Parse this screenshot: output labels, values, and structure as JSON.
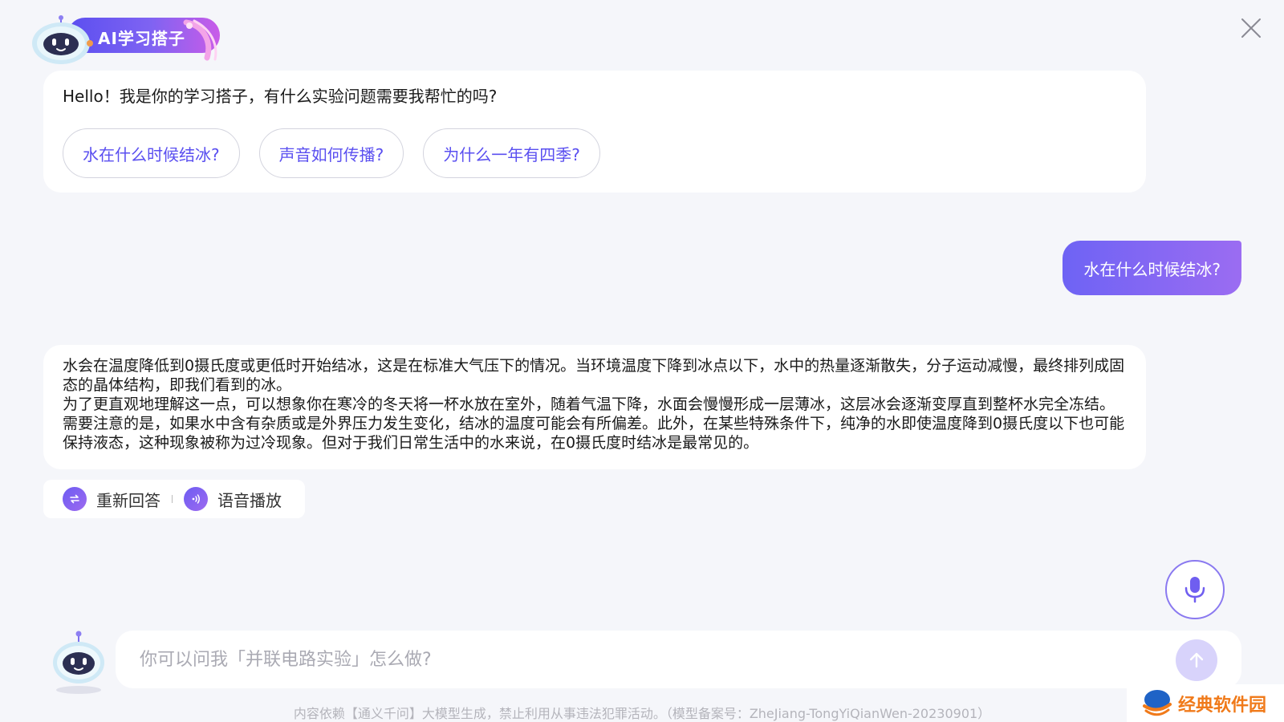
{
  "header": {
    "title": "AI学习搭子",
    "close_icon": "close-icon"
  },
  "greeting": {
    "text": "Hello！我是你的学习搭子，有什么实验问题需要我帮忙的吗?",
    "suggestions": [
      {
        "label": "水在什么时候结冰?"
      },
      {
        "label": "声音如何传播?"
      },
      {
        "label": "为什么一年有四季?"
      }
    ]
  },
  "user_message": "水在什么时候结冰?",
  "answer": {
    "paragraphs": [
      "水会在温度降低到0摄氏度或更低时开始结冰，这是在标准大气压下的情况。当环境温度下降到冰点以下，水中的热量逐渐散失，分子运动减慢，最终排列成固态的晶体结构，即我们看到的冰。",
      "为了更直观地理解这一点，可以想象你在寒冷的冬天将一杯水放在室外，随着气温下降，水面会慢慢形成一层薄冰，这层冰会逐渐变厚直到整杯水完全冻结。需要注意的是，如果水中含有杂质或是外界压力发生变化，结冰的温度可能会有所偏差。此外，在某些特殊条件下，纯净的水即使温度降到0摄氏度以下也可能保持液态，这种现象被称为过冷现象。但对于我们日常生活中的水来说，在0摄氏度时结冰是最常见的。"
    ]
  },
  "actions": {
    "regenerate_label": "重新回答",
    "speak_label": "语音播放"
  },
  "input": {
    "placeholder": "你可以问我「并联电路实验」怎么做?",
    "value": ""
  },
  "disclaimer": "内容依赖【通义千问】大模型生成，禁止利用从事违法犯罪活动。（模型备案号：ZheJiang-TongYiQianWen-20230901）",
  "watermark": "经典软件园",
  "colors": {
    "accent": "#6e63f4",
    "accent_end": "#9b6cf2",
    "chip_text": "#5a4ff0",
    "background": "#f5f6fa",
    "watermark": "#f07a1a"
  }
}
